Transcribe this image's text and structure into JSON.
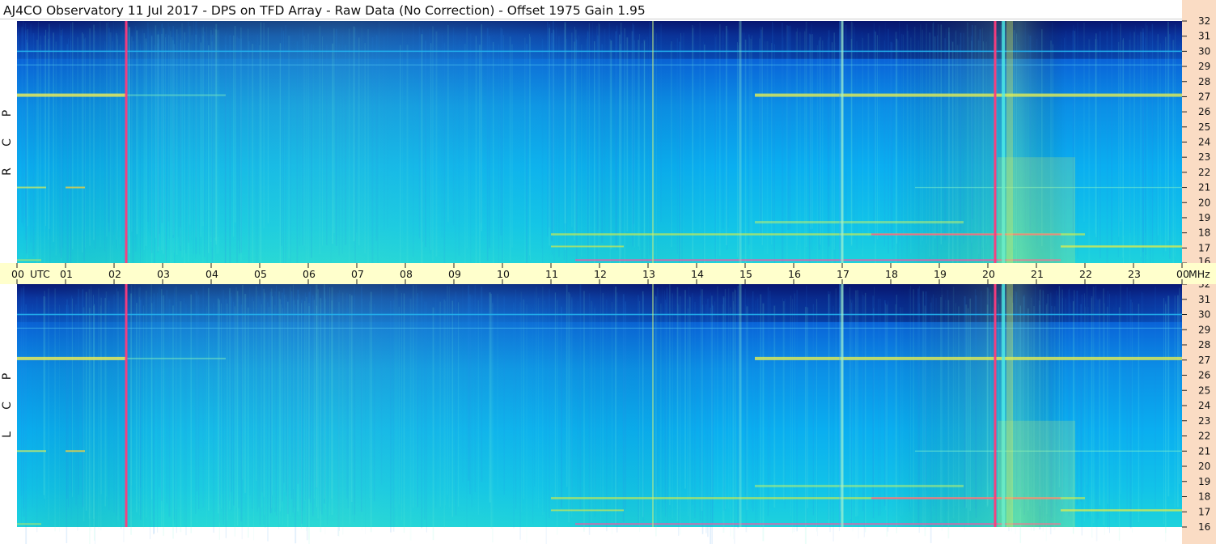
{
  "header": {
    "title": "AJ4CO Observatory  11 Jul 2017  -  DPS on TFD Array  -  Raw Data (No Correction)  -  Offset 1975  Gain 1.95"
  },
  "panels": [
    {
      "id": "rcp",
      "label_letters": [
        "P",
        "C",
        "R"
      ]
    },
    {
      "id": "lcp",
      "label_letters": [
        "P",
        "C",
        "L"
      ]
    }
  ],
  "colors": {
    "axis_band": "#ffffcc",
    "freq_axis_bg": "#fadcc4",
    "spectrum_low": "#0a1f8c",
    "spectrum_mid": "#0aa4e0",
    "spectrum_high": "#f7f25a",
    "interference": "#ff3a7c"
  },
  "chart_data": {
    "type": "heatmap",
    "title": "AJ4CO Observatory  11 Jul 2017  -  DPS on TFD Array  -  Raw Data (No Correction)  -  Offset 1975  Gain 1.95",
    "x_axis": {
      "unit_label": "UTC",
      "ticks": [
        "00",
        "01",
        "02",
        "03",
        "04",
        "05",
        "06",
        "07",
        "08",
        "09",
        "10",
        "11",
        "12",
        "13",
        "14",
        "15",
        "16",
        "17",
        "18",
        "19",
        "20",
        "21",
        "22",
        "23",
        "00"
      ],
      "range_hours": [
        0,
        24
      ]
    },
    "y_axis": {
      "unit_label": "MHz",
      "ticks": [
        32,
        31,
        30,
        29,
        28,
        27,
        26,
        25,
        24,
        23,
        22,
        21,
        20,
        19,
        18,
        17,
        16
      ],
      "range_mhz": [
        16,
        32
      ]
    },
    "series": [
      {
        "name": "R C P"
      },
      {
        "name": "L C P"
      }
    ],
    "features": {
      "broadband_lines_utc": [
        2.25,
        13.1,
        17.0,
        20.15,
        20.35
      ],
      "persistent_bands_mhz": [
        30.0,
        27.1,
        21.0,
        17.9,
        17.1
      ],
      "strong_interference_utc": [
        2.25,
        20.15
      ]
    }
  }
}
